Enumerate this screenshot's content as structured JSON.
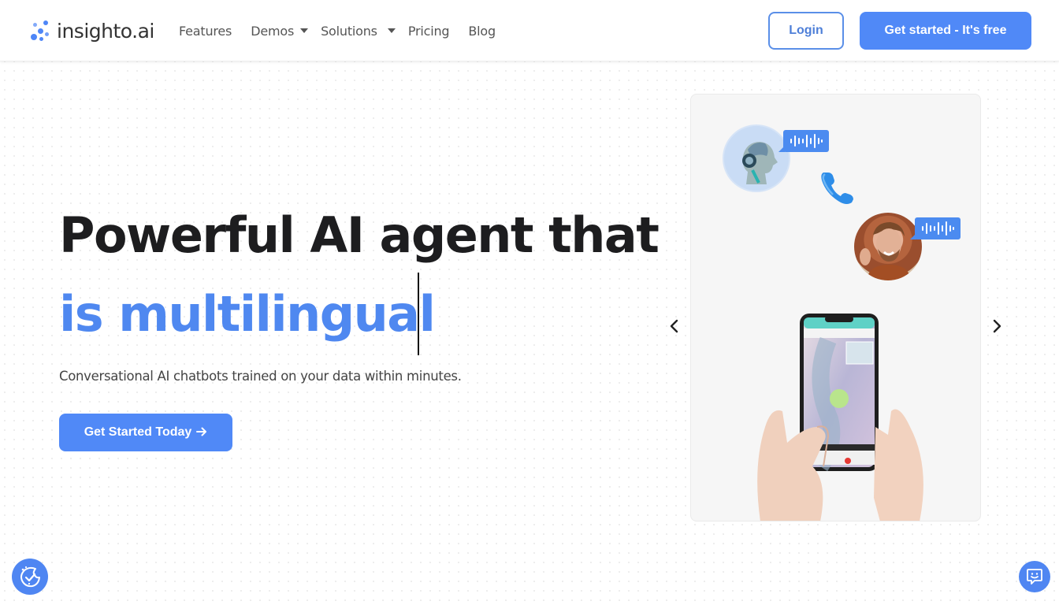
{
  "header": {
    "logo_text": "insighto.ai",
    "nav": [
      {
        "label": "Features",
        "has_dropdown": false
      },
      {
        "label": "Demos",
        "has_dropdown": true
      },
      {
        "label": "Solutions",
        "has_dropdown": true
      },
      {
        "label": "Pricing",
        "has_dropdown": false
      },
      {
        "label": "Blog",
        "has_dropdown": false
      }
    ],
    "login_label": "Login",
    "cta_label": "Get started - It's free"
  },
  "hero": {
    "headline": "Powerful AI agent that",
    "headline_accent": "is multilingual",
    "subtext": "Conversational AI chatbots trained on your data within minutes.",
    "button_label": "Get Started Today",
    "button_icon": "arrow-right-icon"
  },
  "carousel": {
    "prev_icon": "chevron-left-icon",
    "next_icon": "chevron-right-icon",
    "slide": {
      "bot_avatar": "ai-robot-avatar",
      "user_avatar": "user-avatar",
      "voice_bubble_icon": "audio-waveform-icon",
      "call_icon": "phone-icon",
      "illustration": "hands-holding-phone"
    }
  },
  "widgets": {
    "left_icon": "cookie-consent-icon",
    "right_icon": "chatbot-icon"
  },
  "colors": {
    "brand": "#5089f7",
    "accent_text": "#4f88f0",
    "headline": "#1d1d1f",
    "body_text": "#444444"
  }
}
